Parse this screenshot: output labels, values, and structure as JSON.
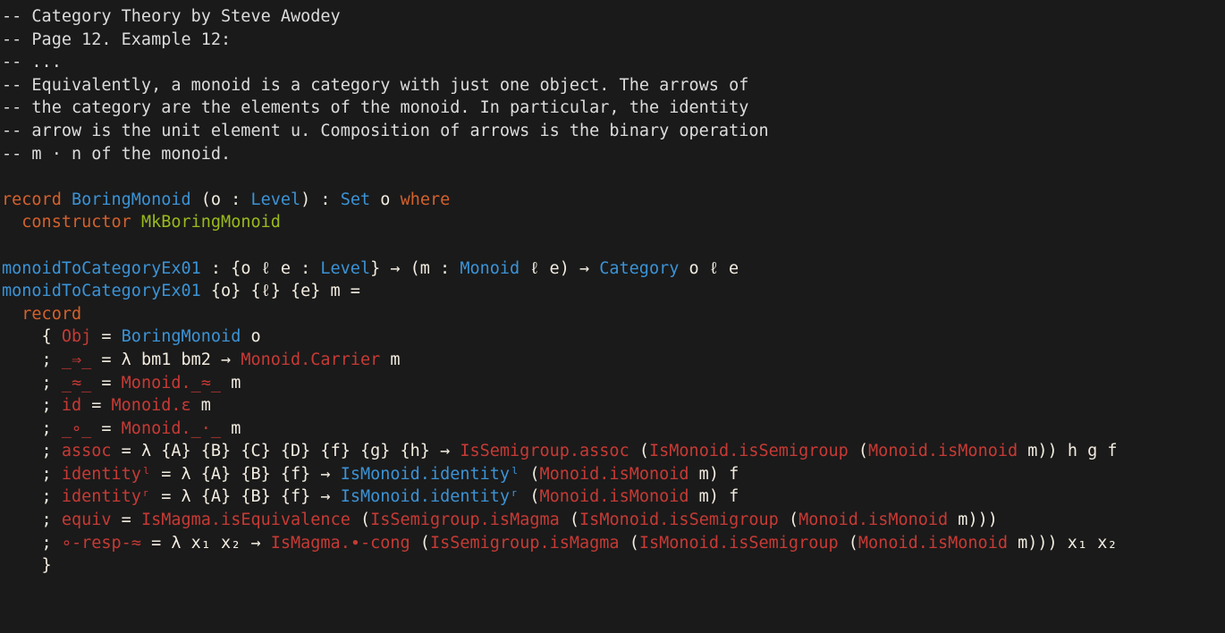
{
  "editor": {
    "language": "agda",
    "background_color": "#1a1a1a",
    "colors": {
      "comment": "#dcdcdc",
      "keyword": "#d4612c",
      "type": "#3b93d6",
      "constructor": "#99ba1c",
      "field": "#c73a35",
      "plain": "#f2ece0"
    }
  },
  "code": {
    "lines": [
      {
        "id": "l1",
        "tokens": [
          {
            "t": "-- Category Theory by Steve Awodey",
            "c": "cmt"
          }
        ]
      },
      {
        "id": "l2",
        "tokens": [
          {
            "t": "-- Page 12. Example 12:",
            "c": "cmt"
          }
        ]
      },
      {
        "id": "l3",
        "tokens": [
          {
            "t": "-- ...",
            "c": "cmt"
          }
        ]
      },
      {
        "id": "l4",
        "tokens": [
          {
            "t": "-- Equivalently, a monoid is a category with just one object. The arrows of",
            "c": "cmt"
          }
        ]
      },
      {
        "id": "l5",
        "tokens": [
          {
            "t": "-- the category are the elements of the monoid. In particular, the identity",
            "c": "cmt"
          }
        ]
      },
      {
        "id": "l6",
        "tokens": [
          {
            "t": "-- arrow is the unit element u. Composition of arrows is the binary operation",
            "c": "cmt"
          }
        ]
      },
      {
        "id": "l7",
        "tokens": [
          {
            "t": "-- m · n of the monoid.",
            "c": "cmt"
          }
        ]
      },
      {
        "id": "l8",
        "tokens": []
      },
      {
        "id": "l9",
        "tokens": [
          {
            "t": "record",
            "c": "kw"
          },
          {
            "t": " ",
            "c": "pln"
          },
          {
            "t": "BoringMonoid",
            "c": "typ"
          },
          {
            "t": " (o : ",
            "c": "pln"
          },
          {
            "t": "Level",
            "c": "typ"
          },
          {
            "t": ") : ",
            "c": "pln"
          },
          {
            "t": "Set",
            "c": "typ"
          },
          {
            "t": " o ",
            "c": "pln"
          },
          {
            "t": "where",
            "c": "kw"
          }
        ]
      },
      {
        "id": "l10",
        "tokens": [
          {
            "t": "  ",
            "c": "pln"
          },
          {
            "t": "constructor",
            "c": "kw"
          },
          {
            "t": " ",
            "c": "pln"
          },
          {
            "t": "MkBoringMonoid",
            "c": "ctor"
          }
        ]
      },
      {
        "id": "l11",
        "tokens": []
      },
      {
        "id": "l12",
        "tokens": [
          {
            "t": "monoidToCategoryEx01",
            "c": "typ"
          },
          {
            "t": " : {o ℓ e : ",
            "c": "pln"
          },
          {
            "t": "Level",
            "c": "typ"
          },
          {
            "t": "} → (m : ",
            "c": "pln"
          },
          {
            "t": "Monoid",
            "c": "typ"
          },
          {
            "t": " ℓ e) → ",
            "c": "pln"
          },
          {
            "t": "Category",
            "c": "typ"
          },
          {
            "t": " o ℓ e",
            "c": "pln"
          }
        ]
      },
      {
        "id": "l13",
        "tokens": [
          {
            "t": "monoidToCategoryEx01",
            "c": "typ"
          },
          {
            "t": " {o} {ℓ} {e} m =",
            "c": "pln"
          }
        ]
      },
      {
        "id": "l14",
        "tokens": [
          {
            "t": "  ",
            "c": "pln"
          },
          {
            "t": "record",
            "c": "kw"
          }
        ]
      },
      {
        "id": "l15",
        "tokens": [
          {
            "t": "    { ",
            "c": "pln"
          },
          {
            "t": "Obj",
            "c": "fld"
          },
          {
            "t": " = ",
            "c": "pln"
          },
          {
            "t": "BoringMonoid",
            "c": "typ"
          },
          {
            "t": " o",
            "c": "pln"
          }
        ]
      },
      {
        "id": "l16",
        "tokens": [
          {
            "t": "    ; ",
            "c": "pln"
          },
          {
            "t": "_⇒_",
            "c": "fld"
          },
          {
            "t": " = λ bm1 bm2 → ",
            "c": "pln"
          },
          {
            "t": "Monoid.Carrier",
            "c": "fld"
          },
          {
            "t": " m",
            "c": "pln"
          }
        ]
      },
      {
        "id": "l17",
        "tokens": [
          {
            "t": "    ; ",
            "c": "pln"
          },
          {
            "t": "_≈_",
            "c": "fld"
          },
          {
            "t": " = ",
            "c": "pln"
          },
          {
            "t": "Monoid._≈_",
            "c": "fld"
          },
          {
            "t": " m",
            "c": "pln"
          }
        ]
      },
      {
        "id": "l18",
        "tokens": [
          {
            "t": "    ; ",
            "c": "pln"
          },
          {
            "t": "id",
            "c": "fld"
          },
          {
            "t": " = ",
            "c": "pln"
          },
          {
            "t": "Monoid.ε",
            "c": "fld"
          },
          {
            "t": " m",
            "c": "pln"
          }
        ]
      },
      {
        "id": "l19",
        "tokens": [
          {
            "t": "    ; ",
            "c": "pln"
          },
          {
            "t": "_∘_",
            "c": "fld"
          },
          {
            "t": " = ",
            "c": "pln"
          },
          {
            "t": "Monoid._·_",
            "c": "fld"
          },
          {
            "t": " m",
            "c": "pln"
          }
        ]
      },
      {
        "id": "l20",
        "tokens": [
          {
            "t": "    ; ",
            "c": "pln"
          },
          {
            "t": "assoc",
            "c": "fld"
          },
          {
            "t": " = λ {A} {B} {C} {D} {f} {g} {h} → ",
            "c": "pln"
          },
          {
            "t": "IsSemigroup.assoc",
            "c": "fld"
          },
          {
            "t": " (",
            "c": "pln"
          },
          {
            "t": "IsMonoid.isSemigroup",
            "c": "fld"
          },
          {
            "t": " (",
            "c": "pln"
          },
          {
            "t": "Monoid.isMonoid",
            "c": "fld"
          },
          {
            "t": " m)) h g f",
            "c": "pln"
          }
        ]
      },
      {
        "id": "l21",
        "tokens": [
          {
            "t": "    ; ",
            "c": "pln"
          },
          {
            "t": "identityˡ",
            "c": "fld"
          },
          {
            "t": " = λ {A} {B} {f} → ",
            "c": "pln"
          },
          {
            "t": "IsMonoid.identityˡ",
            "c": "typ"
          },
          {
            "t": " (",
            "c": "pln"
          },
          {
            "t": "Monoid.isMonoid",
            "c": "fld"
          },
          {
            "t": " m) f",
            "c": "pln"
          }
        ]
      },
      {
        "id": "l22",
        "tokens": [
          {
            "t": "    ; ",
            "c": "pln"
          },
          {
            "t": "identityʳ",
            "c": "fld"
          },
          {
            "t": " = λ {A} {B} {f} → ",
            "c": "pln"
          },
          {
            "t": "IsMonoid.identityʳ",
            "c": "typ"
          },
          {
            "t": " (",
            "c": "pln"
          },
          {
            "t": "Monoid.isMonoid",
            "c": "fld"
          },
          {
            "t": " m) f",
            "c": "pln"
          }
        ]
      },
      {
        "id": "l23",
        "tokens": [
          {
            "t": "    ; ",
            "c": "pln"
          },
          {
            "t": "equiv",
            "c": "fld"
          },
          {
            "t": " = ",
            "c": "pln"
          },
          {
            "t": "IsMagma.isEquivalence",
            "c": "fld"
          },
          {
            "t": " (",
            "c": "pln"
          },
          {
            "t": "IsSemigroup.isMagma",
            "c": "fld"
          },
          {
            "t": " (",
            "c": "pln"
          },
          {
            "t": "IsMonoid.isSemigroup",
            "c": "fld"
          },
          {
            "t": " (",
            "c": "pln"
          },
          {
            "t": "Monoid.isMonoid",
            "c": "fld"
          },
          {
            "t": " m)))",
            "c": "pln"
          }
        ]
      },
      {
        "id": "l24",
        "tokens": [
          {
            "t": "    ; ",
            "c": "pln"
          },
          {
            "t": "∘-resp-≈",
            "c": "fld"
          },
          {
            "t": " = λ x₁ x₂ → ",
            "c": "pln"
          },
          {
            "t": "IsMagma.∙-cong",
            "c": "fld"
          },
          {
            "t": " (",
            "c": "pln"
          },
          {
            "t": "IsSemigroup.isMagma",
            "c": "fld"
          },
          {
            "t": " (",
            "c": "pln"
          },
          {
            "t": "IsMonoid.isSemigroup",
            "c": "fld"
          },
          {
            "t": " (",
            "c": "pln"
          },
          {
            "t": "Monoid.isMonoid",
            "c": "fld"
          },
          {
            "t": " m))) x₁ x₂",
            "c": "pln"
          }
        ]
      },
      {
        "id": "l25",
        "tokens": [
          {
            "t": "    }",
            "c": "pln"
          }
        ]
      }
    ]
  }
}
